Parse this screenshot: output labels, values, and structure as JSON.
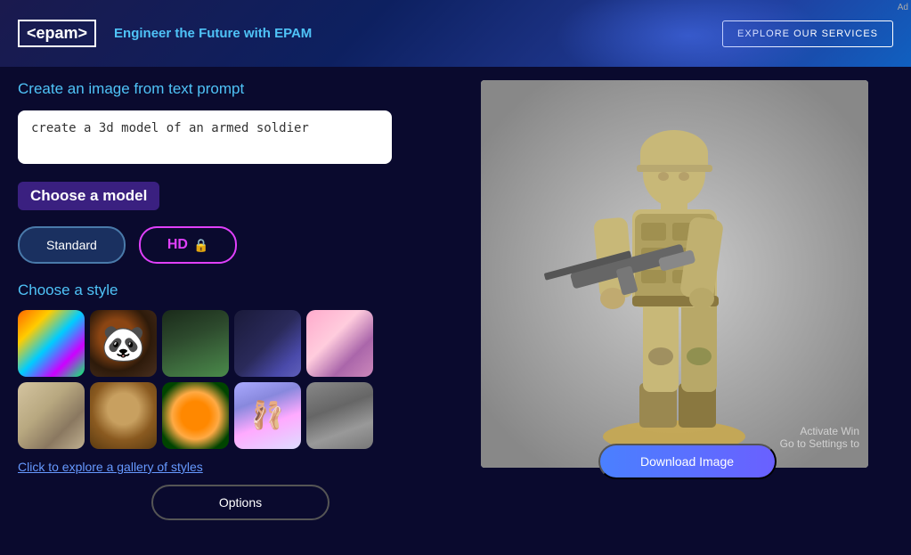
{
  "banner": {
    "logo": "<epam>",
    "tagline_prefix": "Engineer the ",
    "tagline_highlight": "Future",
    "tagline_suffix": " with EPAM",
    "explore_btn": "EXPLORE OUR SERVICES",
    "ad_label": "Ad"
  },
  "main": {
    "section_title": "Create an image from text prompt",
    "prompt_placeholder": "create a 3d model of an armed soldier",
    "prompt_value": "create a 3d model of an armed soldier",
    "choose_model_label": "Choose a model",
    "model_standard_label": "Standard",
    "model_hd_label": "HD",
    "choose_style_label": "Choose a style",
    "gallery_link": "Click to explore a gallery of styles",
    "options_btn": "Options",
    "download_btn": "Download Image",
    "watermark_line1": "Activate Win",
    "watermark_line2": "Go to Settings to",
    "styles": [
      {
        "id": 1,
        "name": "colorful-abstract",
        "css_class": "style-1"
      },
      {
        "id": 2,
        "name": "panda-cartoon",
        "css_class": "style-2"
      },
      {
        "id": 3,
        "name": "forest-realism",
        "css_class": "style-3"
      },
      {
        "id": 4,
        "name": "sci-fi-robot",
        "css_class": "style-4"
      },
      {
        "id": 5,
        "name": "anime-girl",
        "css_class": "style-5"
      },
      {
        "id": 6,
        "name": "sketch-vehicle",
        "css_class": "style-6"
      },
      {
        "id": 7,
        "name": "mona-lisa",
        "css_class": "style-7"
      },
      {
        "id": 8,
        "name": "floral-burst",
        "css_class": "style-8"
      },
      {
        "id": 9,
        "name": "ballet-dancers",
        "css_class": "style-9"
      },
      {
        "id": 10,
        "name": "city-sketch",
        "css_class": "style-10"
      }
    ]
  }
}
